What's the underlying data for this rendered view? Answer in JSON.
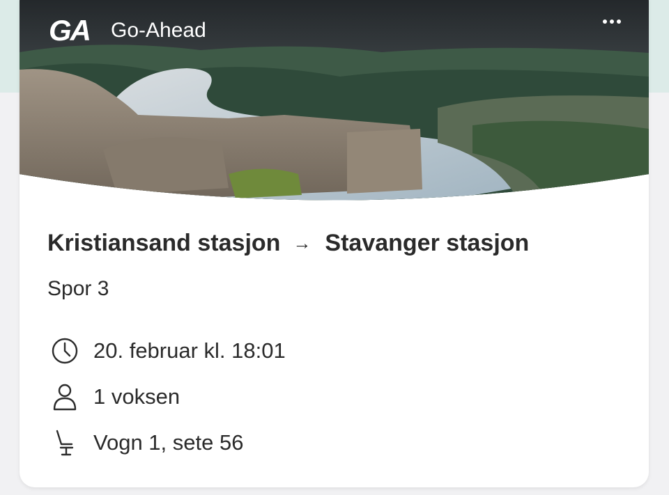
{
  "header": {
    "logo_text": "GA",
    "brand_name": "Go-Ahead",
    "more_icon": "more-horizontal-icon"
  },
  "trip": {
    "from": "Kristiansand stasjon",
    "arrow": "→",
    "to": "Stavanger stasjon",
    "platform": "Spor 3"
  },
  "details": [
    {
      "icon": "clock-icon",
      "text": "20. februar kl. 18:01"
    },
    {
      "icon": "person-icon",
      "text": "1 voksen"
    },
    {
      "icon": "seat-icon",
      "text": "Vogn 1, sete 56"
    }
  ],
  "colors": {
    "background_top": "#dcebe8",
    "background": "#f1f1f3",
    "card": "#ffffff",
    "text": "#2a2a2a"
  }
}
